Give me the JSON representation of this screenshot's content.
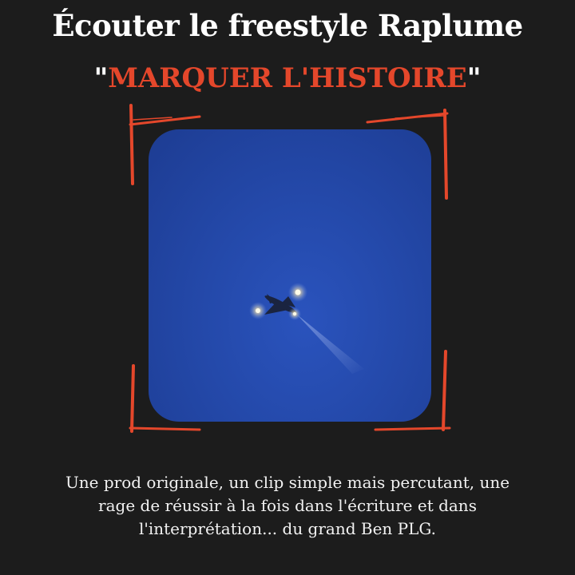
{
  "title": "Écouter le freestyle Raplume",
  "subtitle": {
    "open_quote": "\"",
    "text": "MARQUER L'HISTOIRE",
    "close_quote": "\""
  },
  "caption": {
    "line1": "Une prod originale, un clip simple mais percutant, une",
    "line2": "rage de réussir à la fois dans l'écriture et dans",
    "line3": "l'interprétation... du grand Ben PLG."
  },
  "colors": {
    "background": "#1c1c1c",
    "accent": "#e4472b",
    "text": "#ffffff",
    "sky": "#2449aa"
  },
  "photo": {
    "subject": "airplane-at-night"
  }
}
